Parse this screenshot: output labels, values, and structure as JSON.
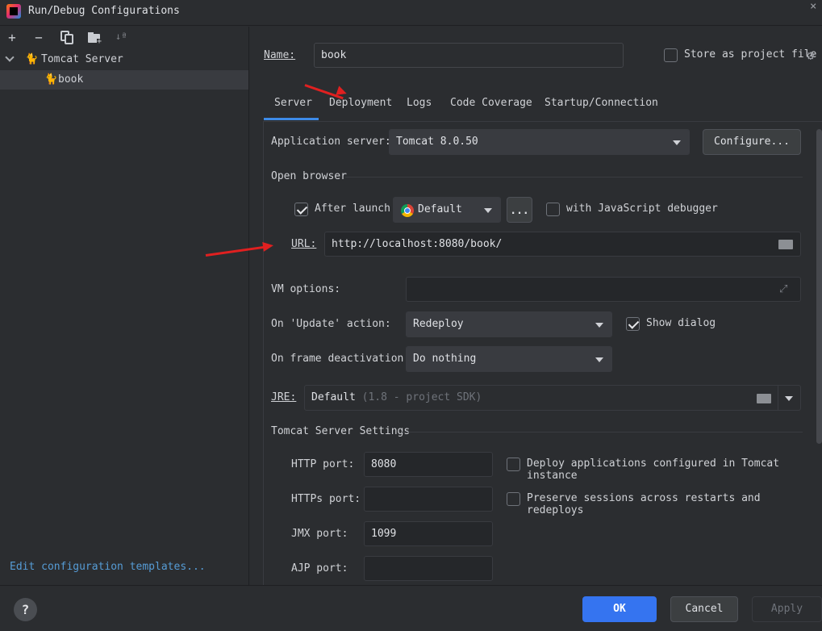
{
  "window": {
    "title": "Run/Debug Configurations"
  },
  "toolbar": {
    "add": "+",
    "remove": "−",
    "copy": "⧉",
    "folder": "▪",
    "sort": "↓ª"
  },
  "tree": {
    "group_label": "Tomcat Server",
    "item_label": "book"
  },
  "left_footer": {
    "edit_templates": "Edit configuration templates..."
  },
  "name_row": {
    "label": "Name:",
    "value": "book",
    "store_label": "Store as project file"
  },
  "tabs": [
    "Server",
    "Deployment",
    "Logs",
    "Code Coverage",
    "Startup/Connection"
  ],
  "server": {
    "app_server_label": "Application server:",
    "app_server_value": "Tomcat 8.0.50",
    "configure_label": "Configure...",
    "open_browser_label": "Open browser",
    "after_launch_label": "After launch",
    "browser_value": "Default",
    "more_label": "...",
    "js_debugger_label": "with JavaScript debugger",
    "url_label": "URL:",
    "url_value": "http://localhost:8080/book/",
    "vm_options_label": "VM options:",
    "vm_options_value": "",
    "on_update_label": "On 'Update' action:",
    "on_update_value": "Redeploy",
    "show_dialog_label": "Show dialog",
    "on_frame_label": "On frame deactivation:",
    "on_frame_value": "Do nothing",
    "jre_label": "JRE:",
    "jre_value": "Default",
    "jre_hint": "(1.8 - project SDK)",
    "tomcat_settings_label": "Tomcat Server Settings",
    "http_port_label": "HTTP port:",
    "http_port_value": "8080",
    "https_port_label": "HTTPs port:",
    "https_port_value": "",
    "jmx_port_label": "JMX port:",
    "jmx_port_value": "1099",
    "ajp_port_label": "AJP port:",
    "ajp_port_value": "",
    "deploy_apps_label": "Deploy applications configured in Tomcat instance",
    "preserve_label": "Preserve sessions across restarts and redeploys"
  },
  "buttons": {
    "help": "?",
    "ok": "OK",
    "cancel": "Cancel",
    "apply": "Apply"
  },
  "colors": {
    "accent": "#3574f0",
    "background": "#2b2d30",
    "annotation_arrow": "#e02020"
  }
}
